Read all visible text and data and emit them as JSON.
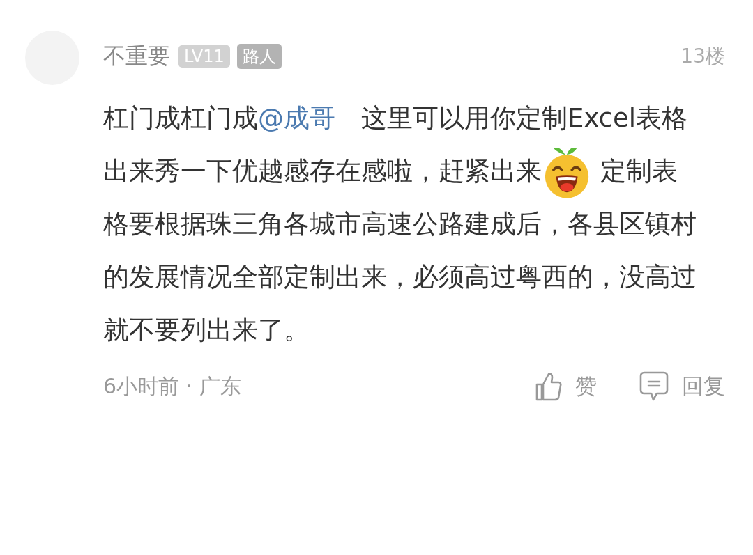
{
  "comment": {
    "username": "不重要",
    "badges": [
      {
        "text": "LV11",
        "kind": "level"
      },
      {
        "text": "路人",
        "kind": "title"
      }
    ],
    "floor": "13楼",
    "content": [
      {
        "kind": "text",
        "text": "杠门成杠门成"
      },
      {
        "kind": "mention",
        "text": "@成哥"
      },
      {
        "kind": "text",
        "text": "　这里可以用你定制Excel表格出来秀一下优越感存在感啦，赶紧出来"
      },
      {
        "kind": "emoji"
      },
      {
        "kind": "text",
        "text": " 定制表格要根据珠三角各城市高速公路建成后，各县区镇村的发展情况全部定制出来，必须高过粤西的，没高过就不要列出来了。"
      }
    ],
    "meta": "6小时前 · 广东",
    "actions": [
      {
        "kind": "like",
        "label": "赞"
      },
      {
        "kind": "reply",
        "label": "回复"
      }
    ]
  }
}
